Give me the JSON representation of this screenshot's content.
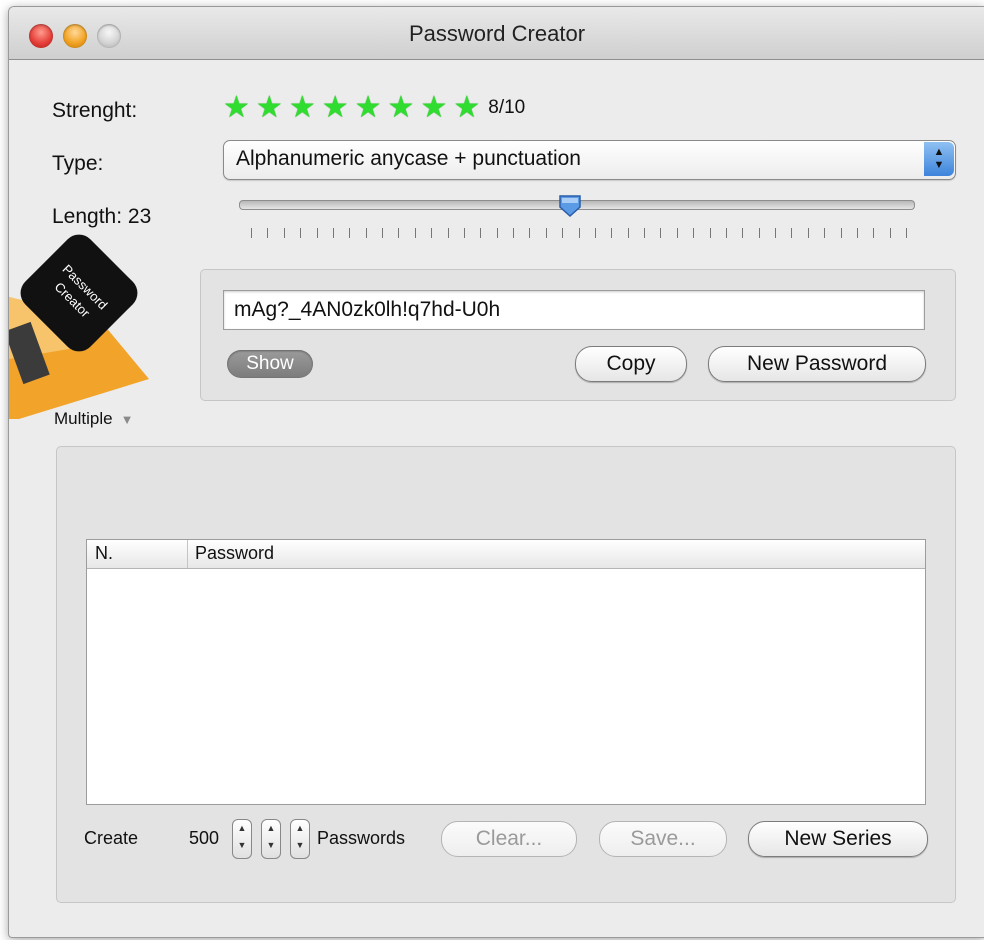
{
  "window": {
    "title": "Password Creator"
  },
  "strength": {
    "label": "Strenght:",
    "score_text": "8/10",
    "stars_filled": 8,
    "star_color": "#2fdc2f"
  },
  "type": {
    "label": "Type:",
    "selected": "Alphanumeric anycase + punctuation"
  },
  "length": {
    "label": "Length: 23",
    "value": 23,
    "slider_fraction": 0.49
  },
  "logo": {
    "text": "Password Creator",
    "accent_color": "#f2a32a"
  },
  "generator": {
    "password": "mAg?_4AN0zk0lh!q7hd-U0h",
    "show_label": "Show",
    "copy_label": "Copy",
    "new_password_label": "New Password"
  },
  "multiple": {
    "label": "Multiple"
  },
  "series": {
    "columns": [
      "N.",
      "Password"
    ],
    "rows": [],
    "create_label": "Create",
    "count": "500",
    "passwords_label": "Passwords",
    "clear_label": "Clear...",
    "save_label": "Save...",
    "new_series_label": "New Series"
  }
}
